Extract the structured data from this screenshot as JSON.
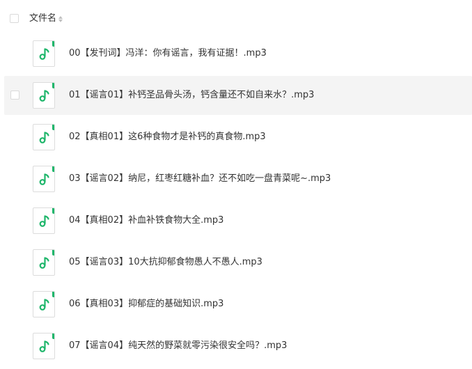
{
  "header": {
    "column_label": "文件名",
    "sort_icon": "sort-caret-icon"
  },
  "accent_color": "#1fb66b",
  "files": [
    {
      "name": "00【发刊词】冯洋：你有谣言，我有证据！.mp3",
      "icon": "music-note-icon"
    },
    {
      "name": "01【谣言01】补钙圣品骨头汤，钙含量还不如自来水？.mp3",
      "icon": "music-note-icon"
    },
    {
      "name": "02【真相01】这6种食物才是补钙的真食物.mp3",
      "icon": "music-note-icon"
    },
    {
      "name": "03【谣言02】纳尼，红枣红糖补血？还不如吃一盘青菜呢~.mp3",
      "icon": "music-note-icon"
    },
    {
      "name": "04【真相02】补血补铁食物大全.mp3",
      "icon": "music-note-icon"
    },
    {
      "name": "05【谣言03】10大抗抑郁食物愚人不愚人.mp3",
      "icon": "music-note-icon"
    },
    {
      "name": "06【真相03】抑郁症的基础知识.mp3",
      "icon": "music-note-icon"
    },
    {
      "name": "07【谣言04】纯天然的野菜就零污染很安全吗？.mp3",
      "icon": "music-note-icon"
    }
  ]
}
